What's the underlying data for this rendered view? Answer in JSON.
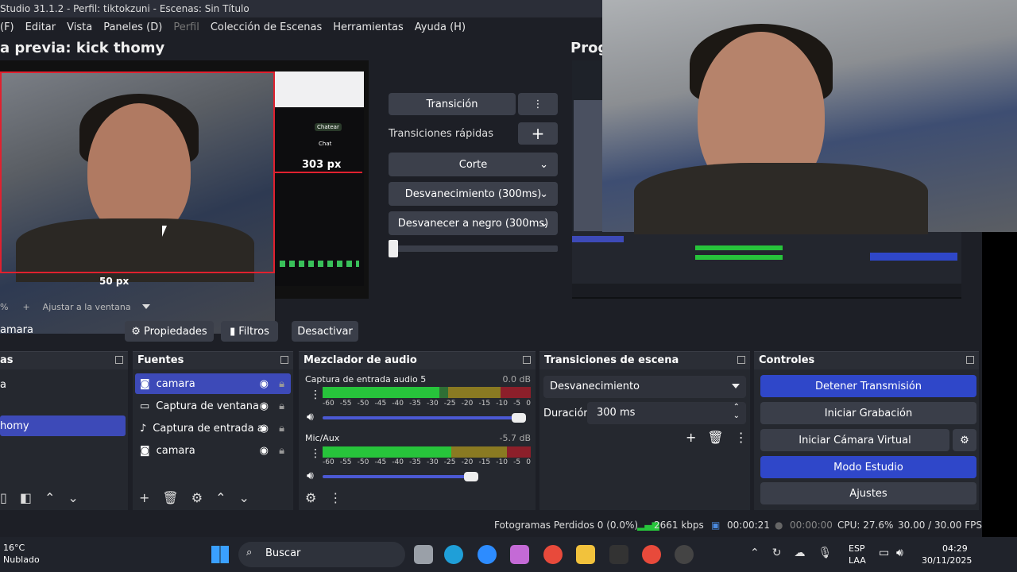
{
  "window": {
    "title": "Studio 31.1.2 - Perfil: tiktokzuni - Escenas: Sin Título"
  },
  "menu": [
    "(F)",
    "Editar",
    "Vista",
    "Paneles (D)",
    "Perfil",
    "Colección de Escenas",
    "Herramientas",
    "Ayuda (H)"
  ],
  "preview": {
    "title": "a previa: kick thomy",
    "label_303": "303 px",
    "label_50": "50 px",
    "chat_button": "Chatear",
    "chat_title": "Chat",
    "zoom_percent": "%",
    "zoom_plus": "+",
    "fit_label": "Ajustar a la ventana"
  },
  "program": {
    "title": "Prog"
  },
  "transitions": {
    "transition_button": "Transición",
    "quick_label": "Transiciones rápidas",
    "items": [
      "Corte",
      "Desvanecimiento (300ms)",
      "Desvanecer a negro (300ms)"
    ],
    "slider_fraction": 0.05
  },
  "scene_bar": {
    "source_name": "amara",
    "properties": "Propiedades",
    "filters": "Filtros",
    "deactivate": "Desactivar"
  },
  "scenes": {
    "title": "as",
    "items": [
      "a",
      "homy"
    ],
    "selected_index": 1
  },
  "sources": {
    "title": "Fuentes",
    "items": [
      {
        "label": "camara",
        "icon": "camera-icon",
        "selected": true
      },
      {
        "label": "Captura de ventana",
        "icon": "window-icon",
        "selected": false
      },
      {
        "label": "Captura de entrada a",
        "icon": "mic-icon",
        "selected": false
      },
      {
        "label": "camara",
        "icon": "camera-icon",
        "selected": false
      }
    ]
  },
  "mixer": {
    "title": "Mezclador de audio",
    "channels": [
      {
        "name": "Captura de entrada audio 5",
        "db": "0.0 dB",
        "level_fraction": 0.56,
        "volume_fraction": 1.0
      },
      {
        "name": "Mic/Aux",
        "db": "-5.7 dB",
        "level_fraction": 0.62,
        "volume_fraction": 0.76
      }
    ],
    "scale": [
      "-60",
      "-55",
      "-50",
      "-45",
      "-40",
      "-35",
      "-30",
      "-25",
      "-20",
      "-15",
      "-10",
      "-5",
      "0"
    ]
  },
  "scene_transitions": {
    "title": "Transiciones de escena",
    "selected": "Desvanecimiento",
    "duration_label": "Duración",
    "duration_value": "300 ms"
  },
  "controls": {
    "title": "Controles",
    "stop_stream": "Detener Transmisión",
    "start_recording": "Iniciar Grabación",
    "start_virtual_cam": "Iniciar Cámara Virtual",
    "studio_mode": "Modo Estudio",
    "settings": "Ajustes"
  },
  "status": {
    "dropped_frames": "Fotogramas Perdidos 0 (0.0%)",
    "bitrate": "2661 kbps",
    "stream_time": "00:00:21",
    "rec_time": "00:00:00",
    "cpu": "CPU: 27.6%",
    "fps": "30.00 / 30.00 FPS"
  },
  "taskbar": {
    "weather_temp": "16°C",
    "weather_desc": "Nublado",
    "search": "Buscar",
    "lang1": "ESP",
    "lang2": "LAA",
    "time": "04:29",
    "date": "30/11/2025"
  },
  "colors": {
    "accent": "#2f47c9",
    "selected": "#3d4ab8",
    "meter_green": "#27c43b",
    "meter_red": "#8c1f2a"
  }
}
